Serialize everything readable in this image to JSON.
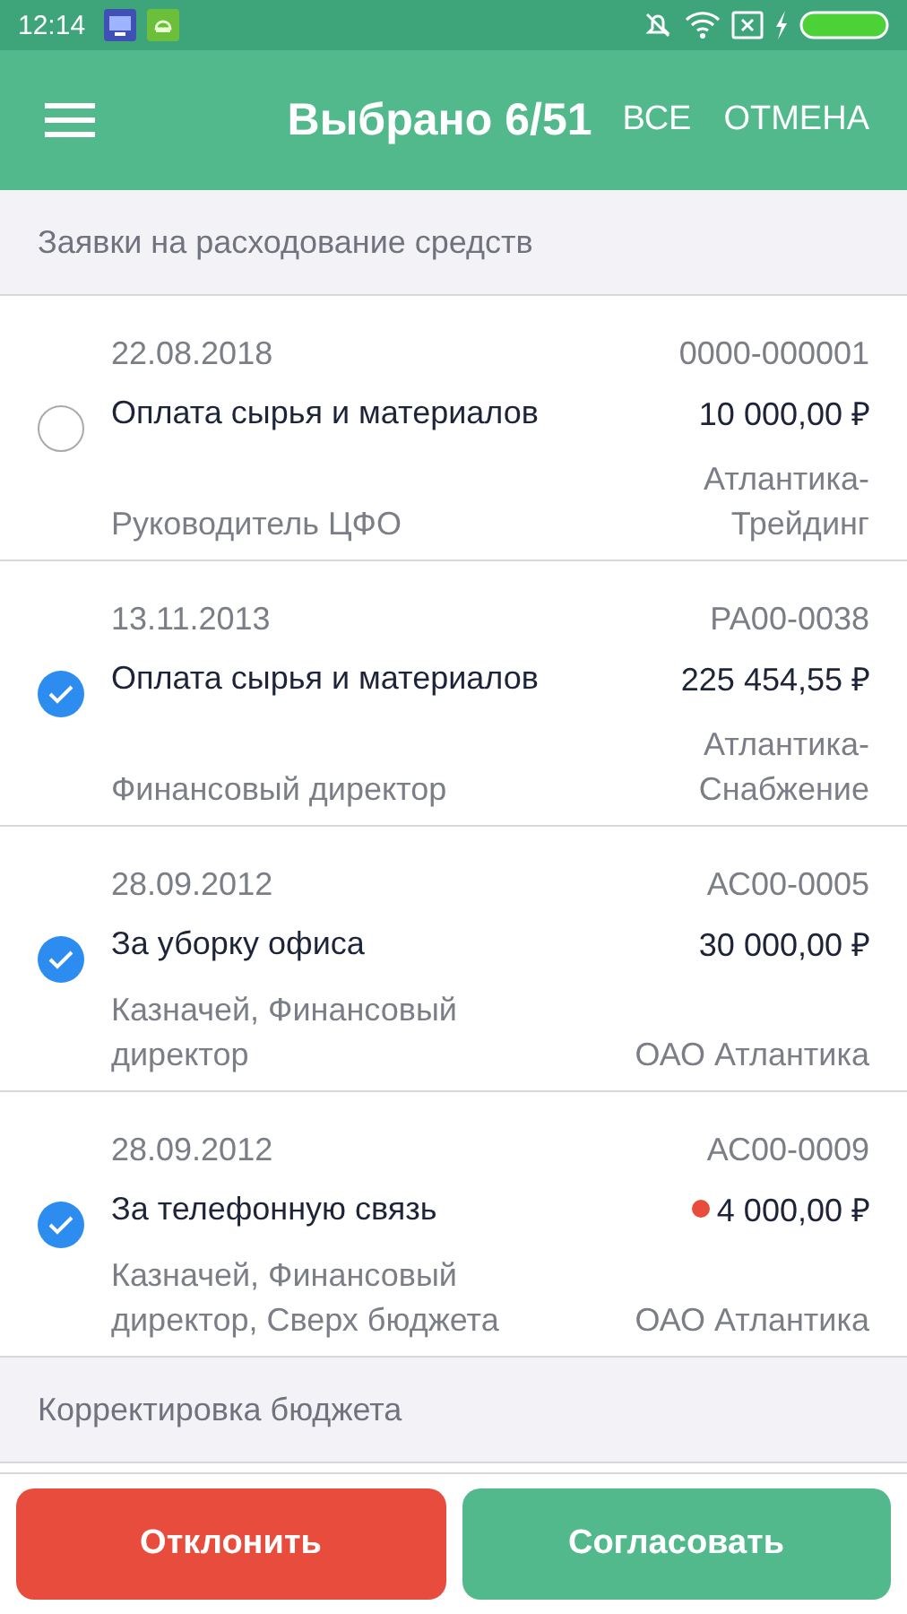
{
  "status_bar": {
    "time": "12:14"
  },
  "app_bar": {
    "title": "Выбрано 6/51",
    "actions": [
      "ВСЕ",
      "ОТМЕНА"
    ]
  },
  "sections": [
    {
      "title": "Заявки на расходование средств",
      "items": [
        {
          "date": "22.08.2018",
          "number": "0000-000001",
          "title": "Оплата сырья и материалов",
          "amount": "10 000,00 ₽",
          "over_budget": false,
          "approvers": "Руководитель ЦФО",
          "organization": "Атлантика-\nТрейдинг",
          "selected": false
        },
        {
          "date": "13.11.2013",
          "number": "РА00-0038",
          "title": "Оплата сырья и материалов",
          "amount": "225 454,55 ₽",
          "over_budget": false,
          "approvers": "Финансовый директор",
          "organization": "Атлантика-\nСнабжение",
          "selected": true
        },
        {
          "date": "28.09.2012",
          "number": "АС00-0005",
          "title": "За уборку офиса",
          "amount": "30 000,00 ₽",
          "over_budget": false,
          "approvers": "Казначей, Финансовый\nдиректор",
          "organization": "ОАО Атлантика",
          "selected": true
        },
        {
          "date": "28.09.2012",
          "number": "АС00-0009",
          "title": "За телефонную связь",
          "amount": "4 000,00 ₽",
          "over_budget": true,
          "approvers": "Казначей, Финансовый\nдиректор, Сверх бюджета",
          "organization": "ОАО Атлантика",
          "selected": true
        }
      ]
    },
    {
      "title": "Корректировка бюджета"
    }
  ],
  "buttons": [
    {
      "label": "Отклонить",
      "kind": "reject"
    },
    {
      "label": "Согласовать",
      "kind": "approve"
    }
  ]
}
